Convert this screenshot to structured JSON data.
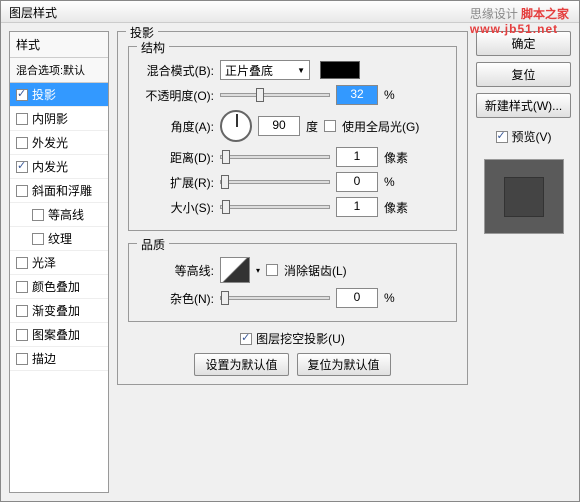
{
  "dialog": {
    "title": "图层样式"
  },
  "watermark": {
    "text1": "思缘设计",
    "text2": "脚本之家",
    "url": "www.jb51.net"
  },
  "sidebar": {
    "header": "样式",
    "sub": "混合选项:默认",
    "items": [
      {
        "label": "投影",
        "checked": true,
        "selected": true
      },
      {
        "label": "内阴影",
        "checked": false
      },
      {
        "label": "外发光",
        "checked": false
      },
      {
        "label": "内发光",
        "checked": true
      },
      {
        "label": "斜面和浮雕",
        "checked": false
      },
      {
        "label": "等高线",
        "checked": false,
        "sub": true
      },
      {
        "label": "纹理",
        "checked": false,
        "sub": true
      },
      {
        "label": "光泽",
        "checked": false
      },
      {
        "label": "颜色叠加",
        "checked": false
      },
      {
        "label": "渐变叠加",
        "checked": false
      },
      {
        "label": "图案叠加",
        "checked": false
      },
      {
        "label": "描边",
        "checked": false
      }
    ]
  },
  "main": {
    "title": "投影",
    "structure": {
      "title": "结构",
      "blend_mode": {
        "label": "混合模式(B):",
        "value": "正片叠底"
      },
      "opacity": {
        "label": "不透明度(O):",
        "value": "32",
        "unit": "%",
        "thumb": 32
      },
      "angle": {
        "label": "角度(A):",
        "value": "90",
        "unit": "度",
        "global": "使用全局光(G)"
      },
      "distance": {
        "label": "距离(D):",
        "value": "1",
        "unit": "像素",
        "thumb": 1
      },
      "spread": {
        "label": "扩展(R):",
        "value": "0",
        "unit": "%",
        "thumb": 0
      },
      "size": {
        "label": "大小(S):",
        "value": "1",
        "unit": "像素",
        "thumb": 1
      }
    },
    "quality": {
      "title": "品质",
      "contour": {
        "label": "等高线:",
        "anti": "消除锯齿(L)"
      },
      "noise": {
        "label": "杂色(N):",
        "value": "0",
        "unit": "%",
        "thumb": 0
      }
    },
    "knockout": "图层挖空投影(U)",
    "set_default": "设置为默认值",
    "reset_default": "复位为默认值"
  },
  "buttons": {
    "ok": "确定",
    "cancel": "复位",
    "new_style": "新建样式(W)...",
    "preview": "预览(V)"
  }
}
